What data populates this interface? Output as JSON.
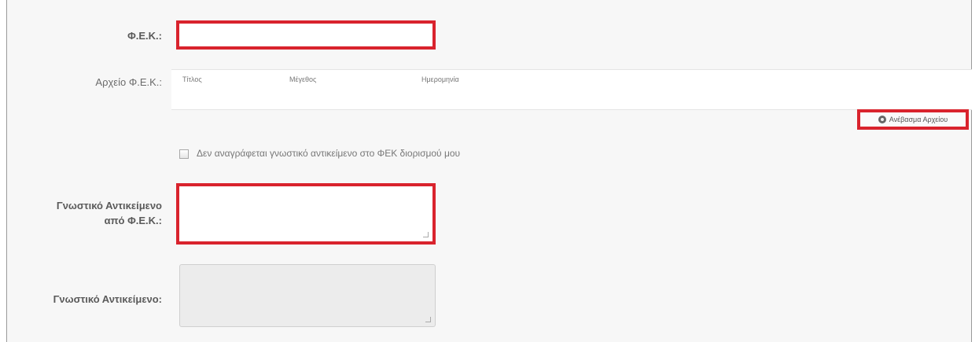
{
  "form": {
    "fek_label": "Φ.Ε.Κ.:",
    "fek_value": "",
    "fek_file_label": "Αρχείο Φ.Ε.Κ.:",
    "files_table": {
      "columns": [
        "Τίτλος",
        "Μέγεθος",
        "Ημερομηνία"
      ]
    },
    "upload_button_label": "Ανέβασμα Αρχείου",
    "no_object_checkbox_label": "Δεν αναγράφεται γνωστικό αντικείμενο στο ΦΕΚ διορισμού μου",
    "knowledge_from_fek_label_line1": "Γνωστικό Αντικείμενο",
    "knowledge_from_fek_label_line2": "από Φ.Ε.Κ.:",
    "knowledge_from_fek_value": "",
    "knowledge_label": "Γνωστικό Αντικείμενο:",
    "knowledge_value": ""
  },
  "colors": {
    "highlight": "#d9232d",
    "panel_bg": "#f7f7f7"
  }
}
